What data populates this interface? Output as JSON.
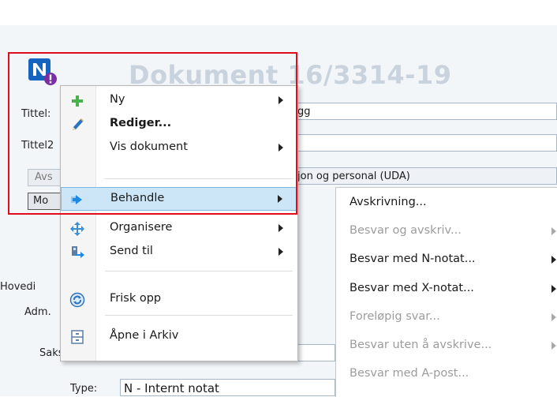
{
  "document": {
    "title": "Dokument 16/3314-19",
    "fields": {
      "tittel_label": "Tittel:",
      "tittel_value": "gg",
      "tittel2_label": "Tittel2",
      "avskriv_button": "Avs",
      "unit_value": "jon og personal (UDA)",
      "mo_button": "Mo",
      "hoved_label": "Hovedi",
      "adm_label": "Adm.",
      "saksbeh_label": "Saksbeh.:",
      "type_label": "Type:",
      "type_value": "N - Internt notat"
    }
  },
  "context_menu": {
    "items": [
      {
        "label": "Ny",
        "icon": "plus-icon",
        "has_submenu": true
      },
      {
        "label": "Rediger...",
        "icon": "pencil-icon",
        "has_submenu": false
      },
      {
        "label": "Vis dokument",
        "icon": "",
        "has_submenu": true
      },
      {
        "label": "Behandle",
        "icon": "process-arrow-icon",
        "has_submenu": true
      },
      {
        "label": "Organisere",
        "icon": "move-arrows-icon",
        "has_submenu": true
      },
      {
        "label": "Send til",
        "icon": "send-to-icon",
        "has_submenu": true
      },
      {
        "label": "Frisk opp",
        "icon": "refresh-icon",
        "has_submenu": false
      },
      {
        "label": "Åpne i Arkiv",
        "icon": "archive-icon",
        "has_submenu": false
      }
    ]
  },
  "submenu": {
    "items": [
      {
        "label": "Avskrivning...",
        "enabled": true,
        "has_submenu": false
      },
      {
        "label": "Besvar og avskriv...",
        "enabled": false,
        "has_submenu": true
      },
      {
        "label": "Besvar med N-notat...",
        "enabled": true,
        "has_submenu": true
      },
      {
        "label": "Besvar med X-notat...",
        "enabled": true,
        "has_submenu": true
      },
      {
        "label": "Foreløpig svar...",
        "enabled": false,
        "has_submenu": true
      },
      {
        "label": "Besvar uten å avskrive...",
        "enabled": false,
        "has_submenu": true
      },
      {
        "label": "Besvar med A-post...",
        "enabled": false,
        "has_submenu": false
      }
    ]
  },
  "colors": {
    "highlight_border": "#e10c1c",
    "active_item_bg": "#cde6f7",
    "logo_blue": "#1565c0",
    "logo_badge": "#7b2fa5"
  }
}
